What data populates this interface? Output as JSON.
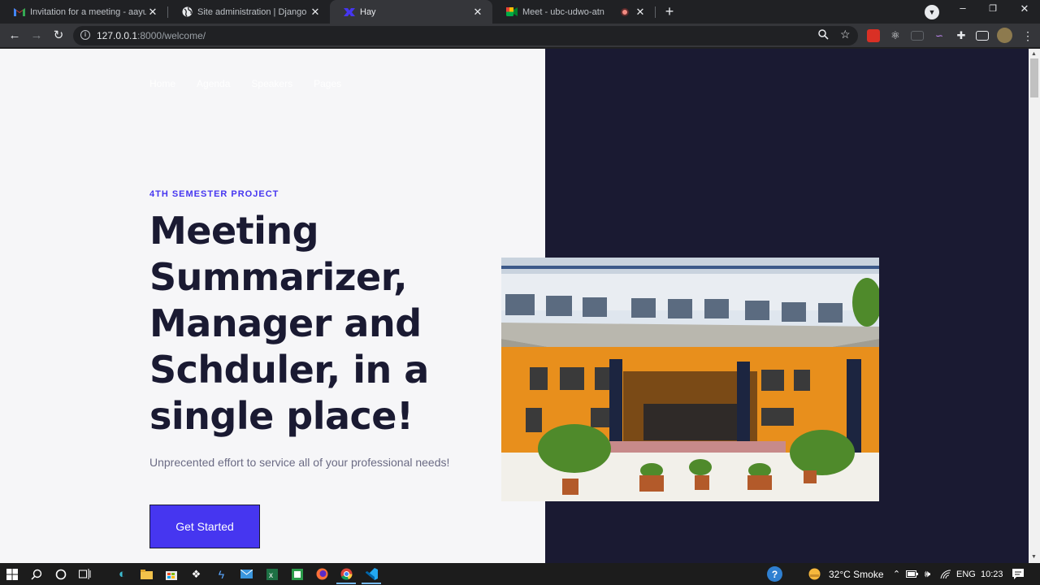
{
  "browser": {
    "tabs": [
      {
        "title": "Invitation for a meeting - aayush",
        "icon": "gmail-icon"
      },
      {
        "title": "Site administration | Django site",
        "icon": "globe-icon"
      },
      {
        "title": "Hay",
        "icon": "hay-icon"
      },
      {
        "title": "Meet - ubc-udwo-atn",
        "icon": "meet-icon"
      }
    ],
    "url_host": "127.0.0.1",
    "url_rest": ":8000/welcome/"
  },
  "site": {
    "nav": [
      "Home",
      "Agenda",
      "Speakers",
      "Pages"
    ],
    "eyebrow": "4TH SEMESTER PROJECT",
    "headline": "Meeting Summarizer, Manager and Schduler, in a single place!",
    "subtitle": "Unprecented effort to service all of your professional needs!",
    "cta": "Get Started"
  },
  "taskbar": {
    "weather": "32°C  Smoke",
    "language": "ENG",
    "time": "10:23"
  },
  "colors": {
    "accent": "#4636f0",
    "dark_panel": "#1a1a32"
  }
}
